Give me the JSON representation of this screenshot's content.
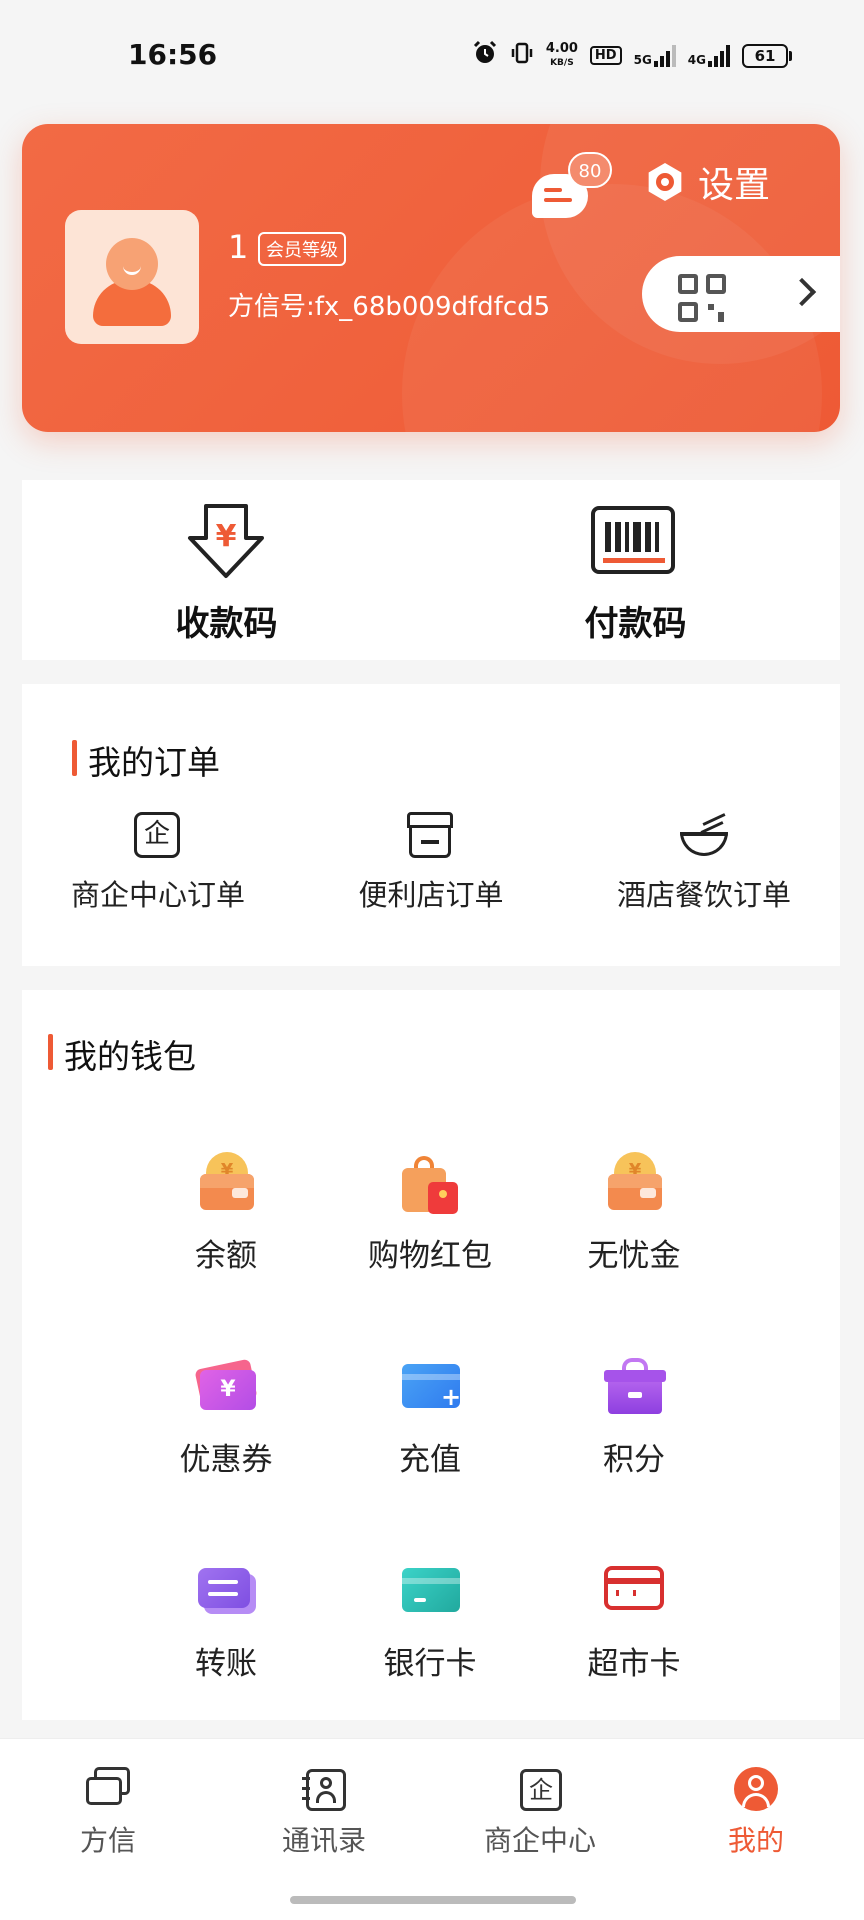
{
  "status_bar": {
    "time": "16:56",
    "speed_value": "4.00",
    "speed_unit": "KB/S",
    "hd_label": "HD",
    "network_5g": "5G",
    "network_4g": "4G",
    "battery": "61",
    "icons": [
      "alarm-icon",
      "vibrate-icon",
      "signal-5g-icon",
      "signal-4g-icon",
      "battery-icon"
    ]
  },
  "profile": {
    "name": "1",
    "member_level": "会员等级",
    "fx_id": "方信号:fx_68b009dfdfcd5",
    "message_badge": "80",
    "settings_label": "设置",
    "accent": "#ee5a35"
  },
  "pay": {
    "receive_label": "收款码",
    "receive_symbol": "¥",
    "pay_label": "付款码"
  },
  "orders": {
    "title": "我的订单",
    "items": [
      {
        "label": "商企中心订单",
        "icon": "enterprise-icon",
        "glyph": "企"
      },
      {
        "label": "便利店订单",
        "icon": "store-icon"
      },
      {
        "label": "酒店餐饮订单",
        "icon": "bowl-icon"
      }
    ]
  },
  "wallet": {
    "title": "我的钱包",
    "items": [
      {
        "label": "余额",
        "icon": "balance-wallet-icon",
        "glyph": "¥"
      },
      {
        "label": "购物红包",
        "icon": "shopping-bag-icon"
      },
      {
        "label": "无忧金",
        "icon": "worry-free-fund-icon",
        "glyph": "¥"
      },
      {
        "label": "优惠券",
        "icon": "coupon-icon",
        "glyph": "¥"
      },
      {
        "label": "充值",
        "icon": "recharge-icon",
        "glyph": "+"
      },
      {
        "label": "积分",
        "icon": "points-gift-icon"
      },
      {
        "label": "转账",
        "icon": "transfer-icon"
      },
      {
        "label": "银行卡",
        "icon": "bank-card-icon"
      },
      {
        "label": "超市卡",
        "icon": "supermarket-card-icon"
      }
    ]
  },
  "bottom_nav": {
    "items": [
      {
        "label": "方信",
        "icon": "chat-icon"
      },
      {
        "label": "通讯录",
        "icon": "contacts-icon"
      },
      {
        "label": "商企中心",
        "icon": "enterprise-center-icon",
        "glyph": "企"
      },
      {
        "label": "我的",
        "icon": "profile-icon"
      }
    ],
    "active": "我的"
  }
}
